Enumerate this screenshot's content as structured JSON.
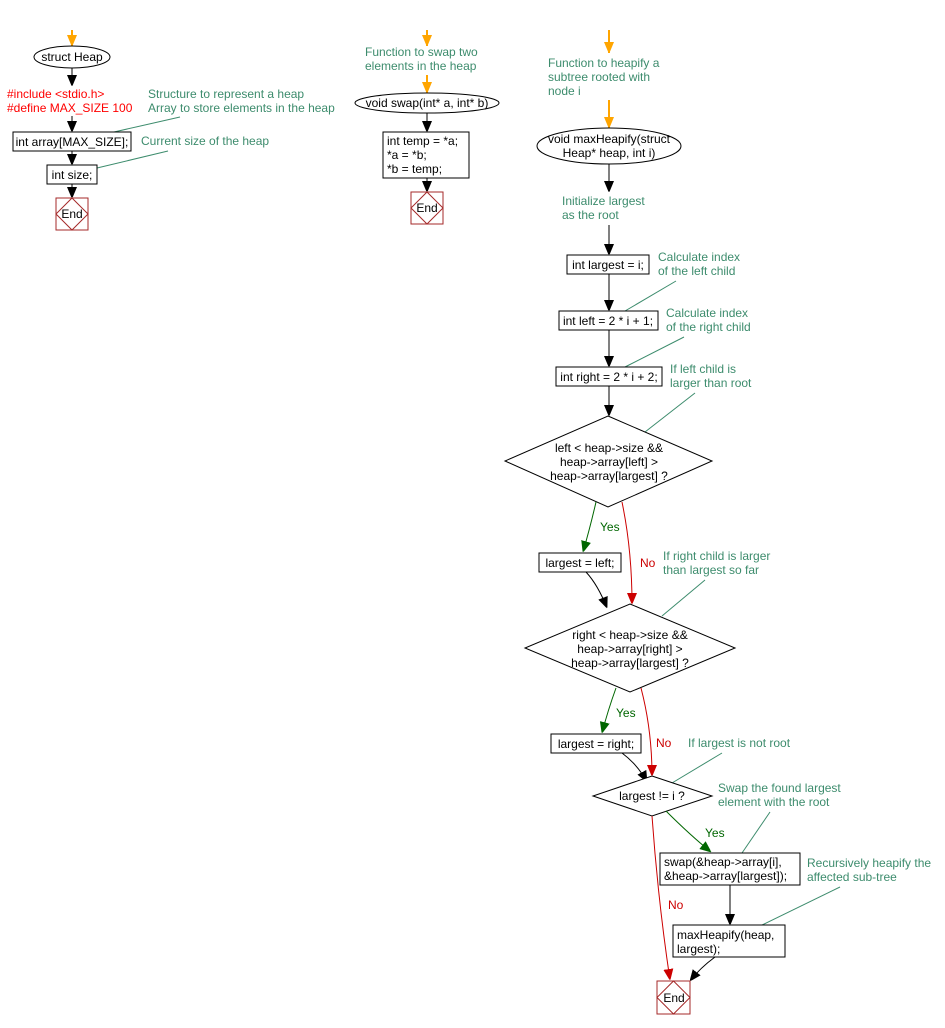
{
  "colors": {
    "comment": "#3d8c6d",
    "preprocessor": "#ff0000",
    "yes": "#006600",
    "no": "#cc0000",
    "start_arrow": "#ffa500",
    "end_border": "#a52a2a"
  },
  "struct": {
    "start": "struct Heap",
    "includes": [
      "#include <stdio.h>",
      "#define MAX_SIZE 100"
    ],
    "comment_struct": [
      "Structure to represent a heap",
      "Array to store elements in the heap"
    ],
    "array_decl": "int array[MAX_SIZE];",
    "comment_size": "Current size of the heap",
    "size_decl": "int size;",
    "end": "End"
  },
  "swap": {
    "comment": [
      "Function to swap two",
      "elements in the heap"
    ],
    "start": "void swap(int* a, int* b)",
    "body": [
      "int temp = *a;",
      "*a = *b;",
      "*b = temp;"
    ],
    "end": "End"
  },
  "heapify": {
    "comment": [
      "Function to heapify a",
      "subtree rooted with",
      "node i"
    ],
    "start": [
      "void maxHeapify(struct",
      "Heap* heap, int i)"
    ],
    "c_init": [
      "Initialize largest",
      "as the root"
    ],
    "init": "int largest = i;",
    "c_left": [
      "Calculate index",
      "of the left child"
    ],
    "left": "int left = 2 * i + 1;",
    "c_right": [
      "Calculate index",
      "of the right child"
    ],
    "right": "int right = 2 * i + 2;",
    "c_cond1": [
      "If left child is",
      "larger than root"
    ],
    "cond1": [
      "left < heap->size &&",
      "heap->array[left] >",
      "heap->array[largest] ?"
    ],
    "yes1": "Yes",
    "no1": "No",
    "assign_left": "largest = left;",
    "c_cond2": [
      "If right child is larger",
      "than largest so far"
    ],
    "cond2": [
      "right < heap->size &&",
      "heap->array[right] >",
      "heap->array[largest] ?"
    ],
    "yes2": "Yes",
    "no2": "No",
    "assign_right": "largest = right;",
    "c_cond3": "If largest is not root",
    "cond3": "largest != i ?",
    "yes3": "Yes",
    "no3": "No",
    "c_swap": [
      "Swap the found largest",
      "element with the root"
    ],
    "swap_call": [
      "swap(&heap->array[i],",
      "&heap->array[largest]);"
    ],
    "c_recurse": [
      "Recursively heapify the",
      "affected sub-tree"
    ],
    "recurse": [
      "maxHeapify(heap,",
      "largest);"
    ],
    "end": "End"
  }
}
